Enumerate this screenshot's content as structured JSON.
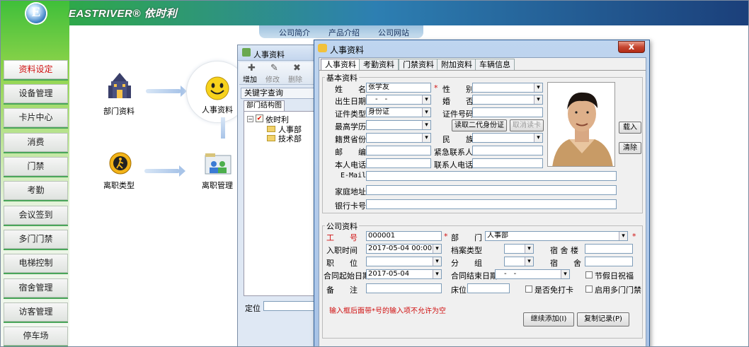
{
  "brand": {
    "name": "EASTRIVER® 依时利",
    "logo_letter": "E"
  },
  "topnav": [
    "公司简介",
    "产品介绍",
    "公司网站"
  ],
  "sidebar": [
    "资料设定",
    "设备管理",
    "卡片中心",
    "消费",
    "门禁",
    "考勤",
    "会议签到",
    "多门门禁",
    "电梯控制",
    "宿舍管理",
    "访客管理",
    "停车场"
  ],
  "canvas": {
    "dept": "部门资料",
    "person": "人事资料",
    "leave_type": "离职类型",
    "leave_mgmt": "离职管理"
  },
  "backwin": {
    "title": "人事资料",
    "toolbar": [
      "增加",
      "修改",
      "删除"
    ],
    "keyword": "关键字查询",
    "tree_tab": "部门结构图",
    "tree_root": "依时利",
    "tree_children": [
      "人事部",
      "技术部"
    ],
    "locate": "定位"
  },
  "win": {
    "title": "人事资料",
    "close": "x",
    "tabs": [
      "人事资料",
      "考勤资料",
      "门禁资料",
      "附加资料",
      "车辆信息"
    ],
    "basic": {
      "legend": "基本资料",
      "name_l": "姓　　名",
      "name_v": "张学友",
      "sex_l": "性　　别",
      "birth_l": "出生日期",
      "birth_v": "　-　-",
      "married_l": "婚　　否",
      "idtype_l": "证件类型",
      "idtype_v": "身份证",
      "idno_l": "证件号码",
      "edu_l": "最高学历",
      "read_btn": "读取二代身份证",
      "cancel_btn": "取消读卡",
      "province_l": "籍贯省份",
      "nation_l": "民　　族",
      "zip_l": "邮　　编",
      "emerg_l": "紧急联系人",
      "phone_l": "本人电话",
      "cphone_l": "联系人电话",
      "email_l": "E-Mail",
      "addr_l": "家庭地址",
      "bank_l": "银行卡号",
      "load_btn": "载入",
      "clear_btn": "清除"
    },
    "company": {
      "legend": "公司资料",
      "workno_l": "工　　号",
      "workno_v": "000001",
      "dept_l": "部　　门",
      "dept_v": "人事部",
      "join_l": "入职时间",
      "join_v": "2017-05-04 00:00:00",
      "archive_l": "档案类型",
      "dorm_l": "宿 舍 楼",
      "position_l": "职　　位",
      "group_l": "分　　组",
      "room_l": "宿　　舍",
      "cstart_l": "合同起始日期",
      "cstart_v": "2017-05-04",
      "cend_l": "合同结束日期",
      "cend_v": "　-　-",
      "holiday_l": "节假日祝福",
      "note_l": "备　　注",
      "bed_l": "床位",
      "nopunch_l": "是否免打卡",
      "multidoor_l": "启用多门门禁"
    },
    "hint": "输入框后面带*号的输入项不允许为空",
    "continue_btn": "继续添加(I)",
    "copy_btn": "复制记录(P)"
  }
}
